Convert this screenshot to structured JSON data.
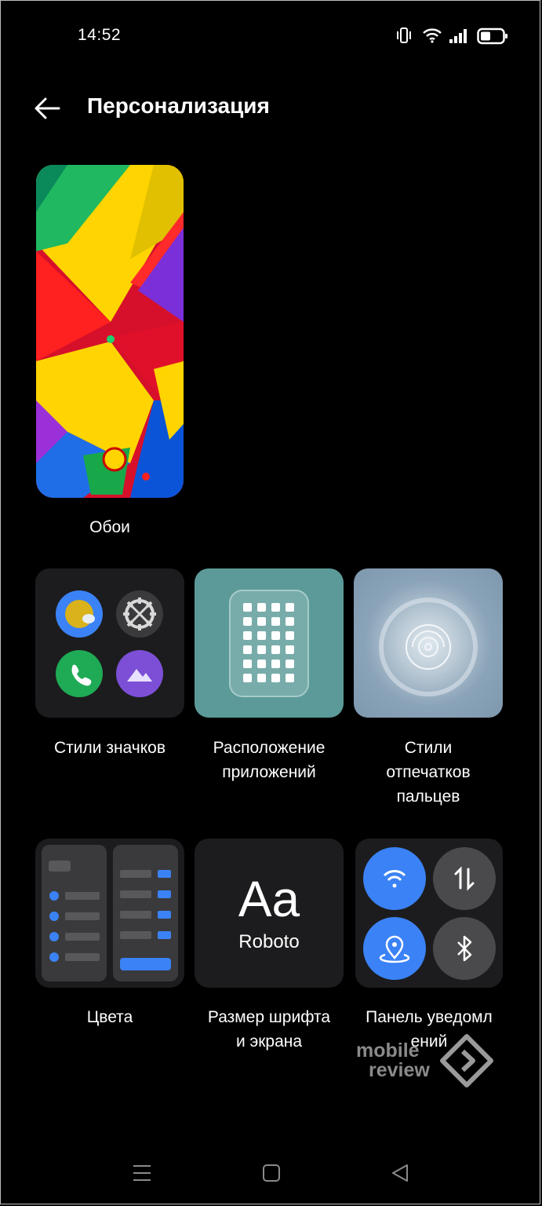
{
  "status_bar": {
    "time": "14:52",
    "icons": [
      "vibrate-icon",
      "wifi-icon",
      "signal-icon",
      "battery-icon"
    ]
  },
  "header": {
    "title": "Персонализация",
    "back_icon": "arrow-left-icon"
  },
  "wallpaper": {
    "label": "Обои"
  },
  "tiles": [
    {
      "id": "icon-styles",
      "label": "Стили значков"
    },
    {
      "id": "app-layout",
      "label_lines": [
        "Расположение",
        "приложений"
      ]
    },
    {
      "id": "fingerprint-styles",
      "label_lines": [
        "Стили",
        "отпечатков",
        "пальцев"
      ]
    },
    {
      "id": "colors",
      "label": "Цвета"
    },
    {
      "id": "font-size",
      "label_lines": [
        "Размер шрифта",
        "и экрана"
      ],
      "preview_text": "Aa",
      "font_name": "Roboto"
    },
    {
      "id": "notification-panel",
      "label_lines": [
        "Панель уведомл",
        "ений"
      ]
    }
  ],
  "watermark": {
    "line1": "mobile",
    "line2": "review"
  },
  "nav_bar": {
    "icons": [
      "menu-icon",
      "home-square-icon",
      "back-triangle-icon"
    ]
  },
  "colors": {
    "accent": "#3b82f6",
    "tile_bg": "#1c1c1e",
    "layout_teal": "#5b9a98"
  }
}
